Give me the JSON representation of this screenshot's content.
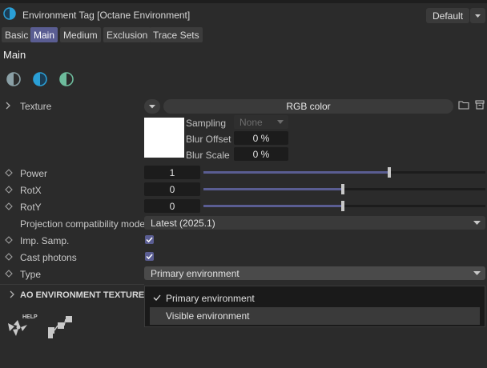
{
  "window": {
    "title": "Environment Tag [Octane Environment]",
    "preset": "Default"
  },
  "tabs": [
    {
      "label": "Basic",
      "active": false
    },
    {
      "label": "Main",
      "active": true
    },
    {
      "label": "Medium",
      "active": false
    },
    {
      "label": "Exclusion",
      "active": false
    },
    {
      "label": "Trace Sets",
      "active": false
    }
  ],
  "section_title": "Main",
  "texture": {
    "label": "Texture",
    "value": "RGB color",
    "swatch_color": "#ffffff",
    "sampling_label": "Sampling",
    "sampling_value": "None",
    "blur_offset_label": "Blur Offset",
    "blur_offset_value": "0 %",
    "blur_scale_label": "Blur Scale",
    "blur_scale_value": "0 %"
  },
  "params": {
    "power": {
      "label": "Power",
      "value": "1",
      "slider": 0.66
    },
    "rotx": {
      "label": "RotX",
      "value": "0",
      "slider": 0.5
    },
    "roty": {
      "label": "RotY",
      "value": "0",
      "slider": 0.5
    },
    "projection": {
      "label": "Projection compatibility mode",
      "value": "Latest (2025.1)"
    },
    "imp_samp": {
      "label": "Imp. Samp.",
      "checked": true
    },
    "cast_photons": {
      "label": "Cast photons",
      "checked": true
    },
    "type": {
      "label": "Type",
      "value": "Primary environment"
    }
  },
  "ao_section": "AO ENVIRONMENT TEXTURE",
  "help_label": "HELP",
  "type_menu": {
    "items": [
      {
        "label": "Primary environment",
        "checked": true
      },
      {
        "label": "Visible environment",
        "checked": false,
        "highlighted": true
      }
    ]
  },
  "colors": {
    "accent": "#5a5d92",
    "background": "#2b2b2b",
    "icon_blue": "#2a9fd6",
    "icon_green": "#6dbb9c"
  }
}
